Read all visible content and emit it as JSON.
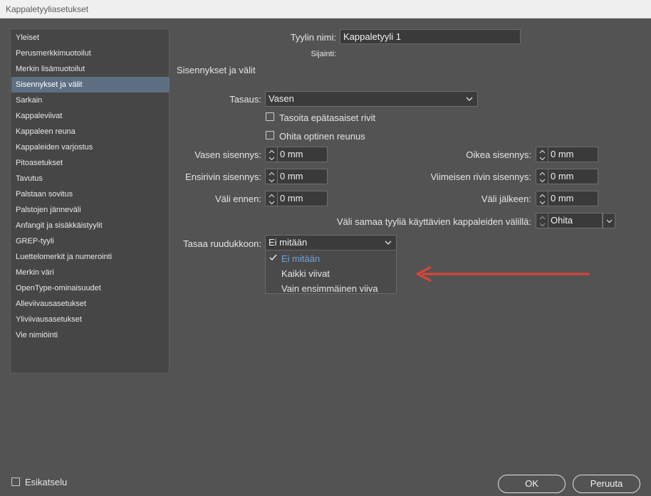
{
  "window": {
    "title": "Kappaletyyliasetukset"
  },
  "sidebar": {
    "items": [
      {
        "label": "Yleiset"
      },
      {
        "label": "Perusmerkkimuotoilut"
      },
      {
        "label": "Merkin lisämuotoilut"
      },
      {
        "label": "Sisennykset ja välit",
        "selected": true
      },
      {
        "label": "Sarkain"
      },
      {
        "label": "Kappaleviivat"
      },
      {
        "label": "Kappaleen reuna"
      },
      {
        "label": "Kappaleiden varjostus"
      },
      {
        "label": "Pitoasetukset"
      },
      {
        "label": "Tavutus"
      },
      {
        "label": "Palstaan sovitus"
      },
      {
        "label": "Palstojen jänneväli"
      },
      {
        "label": "Anfangit ja sisäkkäistyylit"
      },
      {
        "label": "GREP-tyyli"
      },
      {
        "label": "Luettelomerkit ja numerointi"
      },
      {
        "label": "Merkin väri"
      },
      {
        "label": "OpenType-ominaisuudet"
      },
      {
        "label": "Alleviivausasetukset"
      },
      {
        "label": "Yliviivausasetukset"
      },
      {
        "label": "Vie nimiöinti"
      }
    ]
  },
  "header": {
    "style_name_label": "Tyylin nimi:",
    "style_name_value": "Kappaletyyli 1",
    "location_label": "Sijainti:"
  },
  "section": {
    "title": "Sisennykset ja välit"
  },
  "form": {
    "alignment_label": "Tasaus:",
    "alignment_value": "Vasen",
    "balance_ragged_label": "Tasoita epätasaiset rivit",
    "ignore_optical_label": "Ohita optinen reunus",
    "left_indent_label": "Vasen sisennys:",
    "left_indent_value": "0 mm",
    "first_line_indent_label": "Ensirivin sisennys:",
    "first_line_indent_value": "0 mm",
    "space_before_label": "Väli ennen:",
    "space_before_value": "0 mm",
    "right_indent_label": "Oikea sisennys:",
    "right_indent_value": "0 mm",
    "last_line_indent_label": "Viimeisen rivin sisennys:",
    "last_line_indent_value": "0 mm",
    "space_after_label": "Väli jälkeen:",
    "space_after_value": "0 mm",
    "same_style_spacing_label": "Väli samaa tyyliä käyttävien kappaleiden välillä:",
    "same_style_spacing_value": "Ohita",
    "align_grid_label": "Tasaa ruudukkoon:",
    "align_grid_value": "Ei mitään"
  },
  "grid_menu": {
    "options": [
      {
        "label": "Ei mitään",
        "selected": true
      },
      {
        "label": "Kaikki viivat"
      },
      {
        "label": "Vain ensimmäinen viiva"
      }
    ]
  },
  "footer": {
    "preview_label": "Esikatselu",
    "ok_label": "OK",
    "cancel_label": "Peruuta"
  },
  "colors": {
    "background": "#535353",
    "selection": "#5e6f84",
    "selected_option": "#6fa3d9",
    "annotation_arrow": "#e0443a"
  }
}
